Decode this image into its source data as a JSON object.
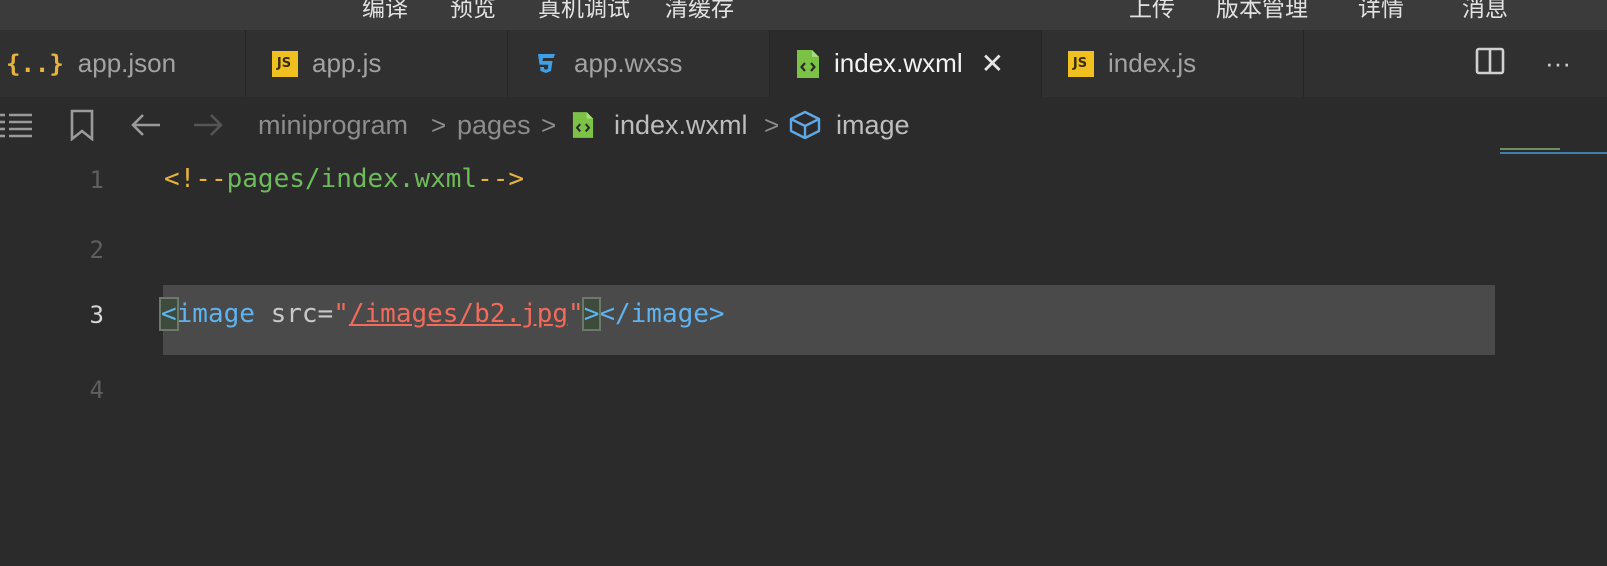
{
  "toolbar": {
    "items": [
      "编译",
      "预览",
      "真机调试",
      "清缓存",
      "上传",
      "版本管理",
      "详情",
      "消息"
    ]
  },
  "tabs": [
    {
      "label": "app.json",
      "icon": "json-braces-icon"
    },
    {
      "label": "app.js",
      "icon": "js-file-icon"
    },
    {
      "label": "app.wxss",
      "icon": "css3-icon"
    },
    {
      "label": "index.wxml",
      "icon": "wxml-file-icon",
      "active": true
    },
    {
      "label": "index.js",
      "icon": "js-file-icon"
    }
  ],
  "tab_actions": {
    "more": "···"
  },
  "breadcrumb": {
    "items": [
      "miniprogram",
      "pages",
      "index.wxml",
      "image"
    ],
    "separator": ">"
  },
  "editor": {
    "line_numbers": [
      "1",
      "2",
      "3",
      "4"
    ],
    "current_line": "3",
    "line1": {
      "open": "<!--",
      "text": "pages/index.wxml",
      "close": "-->"
    },
    "line3": {
      "lt": "<",
      "tag_open": "image",
      "attr": " src=",
      "q1": "\"",
      "value": "/images/b2.jpg",
      "q2": "\"",
      "gt": ">",
      "tag_close": "</image>"
    }
  },
  "colors": {
    "background": "#2b2b2b",
    "tag": "#5fb3ee",
    "string": "#f06b5c",
    "comment": "#6dbb5a",
    "js_icon": "#f0c020"
  }
}
